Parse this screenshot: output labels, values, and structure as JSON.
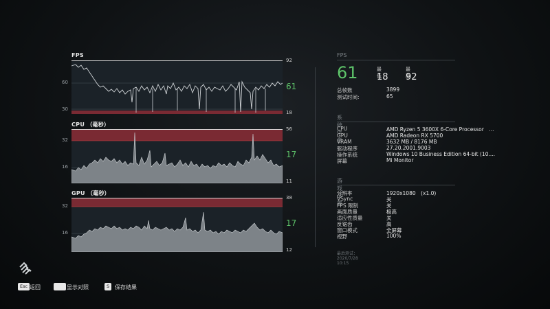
{
  "charts": [
    {
      "title": "FPS",
      "max": "92",
      "min": "18",
      "current": "61",
      "ticks": [
        "60",
        "30"
      ]
    },
    {
      "title": "CPU （毫秒）",
      "max": "56",
      "min": "11",
      "current": "17",
      "ticks": [
        "32",
        "16"
      ]
    },
    {
      "title": "GPU （毫秒）",
      "max": "38",
      "min": "12",
      "current": "17",
      "ticks": [
        "32",
        "16"
      ]
    }
  ],
  "fps_panel": {
    "header": "FPS",
    "current": "61",
    "min_label": "最低",
    "min_value": "18",
    "max_label": "最高",
    "max_value": "92",
    "total_frames_label": "总帧数",
    "total_frames": "3899",
    "test_time_label": "测试时间:",
    "test_time": "65"
  },
  "system_info": {
    "header": "系统信息",
    "rows": [
      {
        "k": "CPU",
        "v": "AMD Ryzen 5 3600X 6-Core Processor　..."
      },
      {
        "k": "GPU",
        "v": "AMD Radeon RX 5700"
      },
      {
        "k": "VRAM",
        "v": "3632 MB / 8176 MB"
      },
      {
        "k": "驱动程序",
        "v": "27.20.2001.9003"
      },
      {
        "k": "操作系统",
        "v": "Windows 10 Business Edition 64-bit (10...."
      },
      {
        "k": "屏幕",
        "v": "Mi Monitor"
      }
    ]
  },
  "game_settings": {
    "header": "游戏设置",
    "rows": [
      {
        "k": "分辨率",
        "v": "1920x1080　(x1.0)"
      },
      {
        "k": "VSync",
        "v": "关"
      },
      {
        "k": "FPS 限制",
        "v": "关"
      },
      {
        "k": "画面质量",
        "v": "极高"
      },
      {
        "k": "适应性质量",
        "v": "关"
      },
      {
        "k": "反锯齿",
        "v": "高"
      },
      {
        "k": "窗口模式",
        "v": "全屏幕"
      },
      {
        "k": "视野",
        "v": "100%"
      }
    ]
  },
  "last_test": "最后测试：　2020/7/28 10:15",
  "controls": [
    {
      "key": "Esc",
      "label": "返回"
    },
    {
      "key": "",
      "label": "显示对照"
    },
    {
      "key": "S",
      "label": "保存结果"
    }
  ],
  "colors": {
    "accent": "#5ec46a",
    "band": "#7a2a33",
    "trace": "#cfd3d6"
  }
}
